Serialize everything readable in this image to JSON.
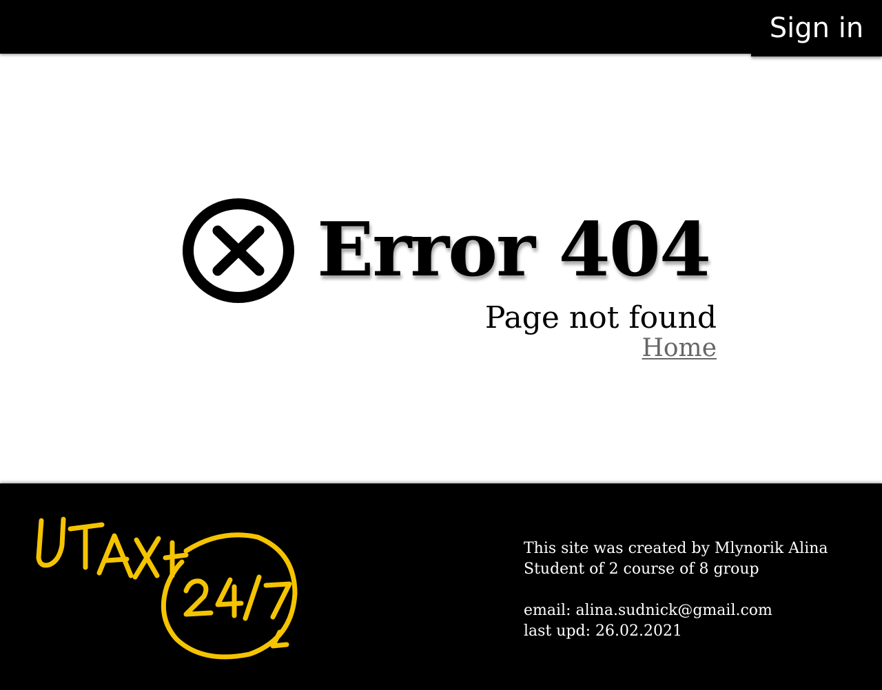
{
  "header": {
    "signin_label": "Sign in"
  },
  "error": {
    "icon": "circle-x-icon",
    "title": "Error 404",
    "subtitle": "Page not found",
    "home_link": "Home"
  },
  "footer": {
    "logo": {
      "brand": "UTAXI",
      "hours": "24/7",
      "color": "#f5c400"
    },
    "credit_line": "This site was created by Mlynorik Alina",
    "student_line": "Student of 2 course of 8 group",
    "email_line": "email: alina.sudnick@gmail.com",
    "updated_line": "last upd: 26.02.2021"
  },
  "colors": {
    "header_bg": "#000000",
    "footer_bg": "#000000",
    "page_bg": "#ffffff",
    "link": "#666666",
    "accent": "#f5c400"
  }
}
